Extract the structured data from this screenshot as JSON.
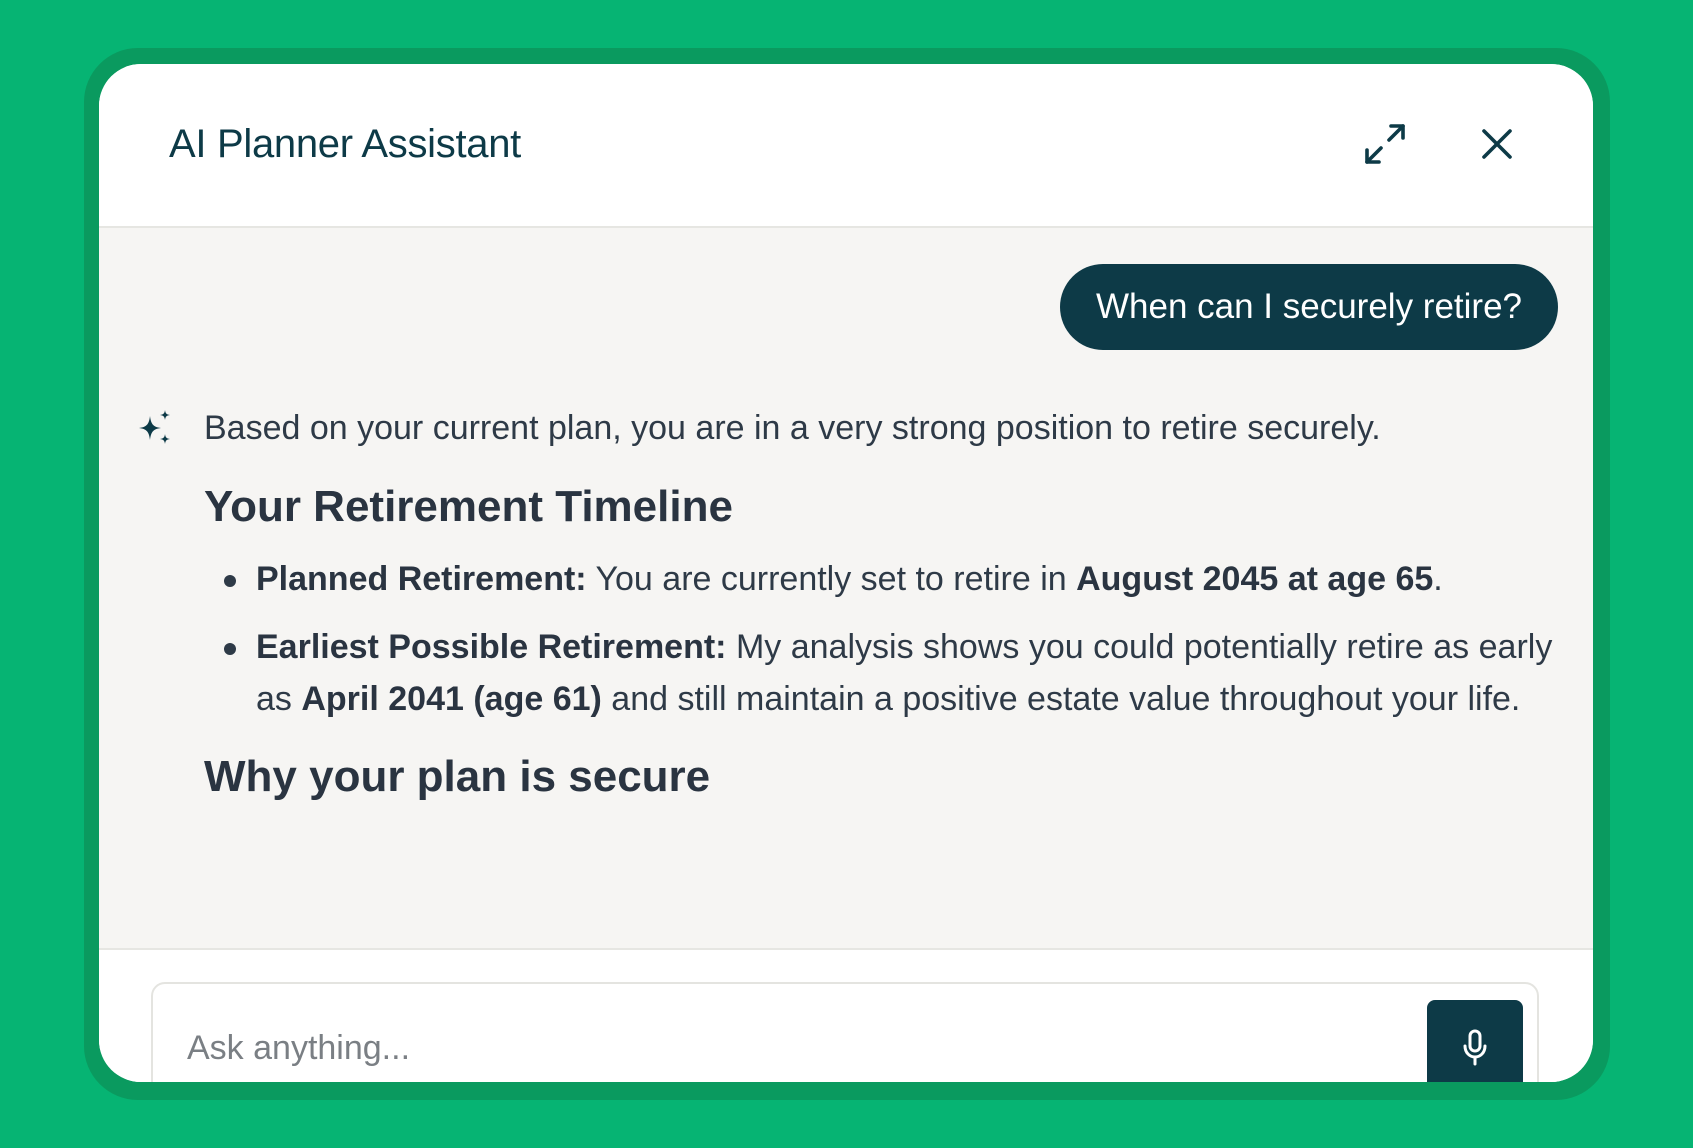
{
  "header": {
    "title": "AI Planner Assistant",
    "expand_icon": "expand-arrows-icon",
    "close_icon": "close-x-icon"
  },
  "conversation": {
    "user_message": "When can I securely retire?",
    "assistant_icon": "sparkles-icon",
    "assistant": {
      "intro": "Based on your current plan, you are in a very strong position to retire securely.",
      "heading_1": "Your Retirement Timeline",
      "bullets": [
        {
          "label": "Planned Retirement:",
          "text_1": " You are currently set to retire in ",
          "bold_1": "August 2045 at age 65",
          "text_2": "."
        },
        {
          "label": "Earliest Possible Retirement:",
          "text_1": " My analysis shows you could potentially retire as early as ",
          "bold_1": "April 2041 (age 61)",
          "text_2": " and still maintain a positive estate value throughout your life."
        }
      ],
      "heading_2": "Why your plan is secure"
    }
  },
  "composer": {
    "placeholder": "Ask anything...",
    "mic_icon": "microphone-icon"
  },
  "colors": {
    "background": "#06b473",
    "accent": "#0d3a47",
    "chat_background": "#f6f5f3"
  }
}
